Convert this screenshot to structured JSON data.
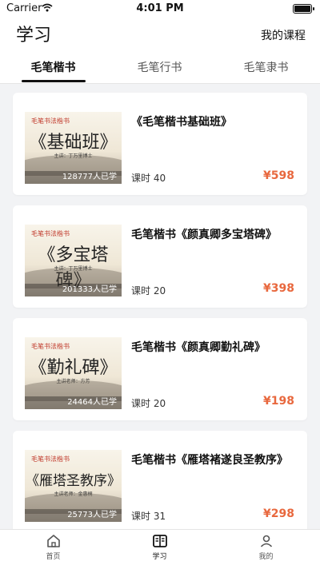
{
  "status_bar": {
    "carrier": "Carrier",
    "time": "4:01 PM"
  },
  "header": {
    "title": "学习",
    "my_courses": "我的课程"
  },
  "tabs": [
    {
      "label": "毛笔楷书"
    },
    {
      "label": "毛笔行书"
    },
    {
      "label": "毛笔隶书"
    }
  ],
  "courses": [
    {
      "thumb_badge": "毛笔书法楷书",
      "thumb_big": "《基础班》",
      "thumb_sub": "主讲：丁万里博士",
      "learners": "128777人已学",
      "title": "《毛笔楷书基础班》",
      "lessons": "课时 40",
      "price": "¥598"
    },
    {
      "thumb_badge": "毛笔书法楷书",
      "thumb_big": "《多宝塔碑》",
      "thumb_sub": "主讲：丁万里博士",
      "learners": "201333人已学",
      "title": "毛笔楷书《颜真卿多宝塔碑》",
      "lessons": "课时 20",
      "price": "¥398"
    },
    {
      "thumb_badge": "毛笔书法楷书",
      "thumb_big": "《勤礼碑》",
      "thumb_sub": "主讲老师：方芳",
      "learners": "24464人已学",
      "title": "毛笔楷书《颜真卿勤礼碑》",
      "lessons": "课时 20",
      "price": "¥198"
    },
    {
      "thumb_badge": "毛笔书法楷书",
      "thumb_big": "《雁塔圣教序》",
      "thumb_sub": "主讲老师：金惠桐",
      "learners": "25773人已学",
      "title": "毛笔楷书《雁塔褚遂良圣教序》",
      "lessons": "课时 31",
      "price": "¥298"
    }
  ],
  "bottom_nav": [
    {
      "label": "首页",
      "icon": "home-icon"
    },
    {
      "label": "学习",
      "icon": "book-icon"
    },
    {
      "label": "我的",
      "icon": "user-icon"
    }
  ],
  "colors": {
    "price": "#e8683e",
    "active": "#111111"
  }
}
